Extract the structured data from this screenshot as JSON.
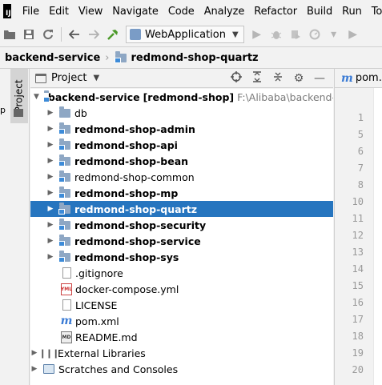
{
  "app": {
    "logo_text": "IJ"
  },
  "menu": [
    "File",
    "Edit",
    "View",
    "Navigate",
    "Code",
    "Analyze",
    "Refactor",
    "Build",
    "Run",
    "Tools"
  ],
  "toolbar": {
    "run_config": "WebApplication",
    "icons": [
      "open-folder-icon",
      "save-icon",
      "sync-icon",
      "back-icon",
      "forward-icon",
      "build-hammer-icon",
      "run-icon",
      "debug-icon",
      "coverage-icon",
      "profile-icon",
      "more-run-icon"
    ]
  },
  "breadcrumb": {
    "items": [
      "backend-service",
      "redmond-shop-quartz"
    ]
  },
  "sidebar": {
    "tab_label": "Project",
    "edge_letter": "p"
  },
  "project_panel": {
    "title": "Project",
    "tools": [
      "locate-icon",
      "expand-all-icon",
      "collapse-all-icon",
      "settings-icon",
      "minimize-icon"
    ]
  },
  "tree": {
    "root": {
      "name": "backend-service",
      "module": "[redmond-shop]",
      "path": "F:\\Alibaba\\backend-service"
    },
    "items": [
      {
        "label": "db",
        "bold": false,
        "type": "folder",
        "selected": false
      },
      {
        "label": "redmond-shop-admin",
        "bold": true,
        "type": "module",
        "selected": false
      },
      {
        "label": "redmond-shop-api",
        "bold": true,
        "type": "module",
        "selected": false
      },
      {
        "label": "redmond-shop-bean",
        "bold": true,
        "type": "module",
        "selected": false
      },
      {
        "label": "redmond-shop-common",
        "bold": false,
        "type": "module",
        "selected": false
      },
      {
        "label": "redmond-shop-mp",
        "bold": true,
        "type": "module",
        "selected": false
      },
      {
        "label": "redmond-shop-quartz",
        "bold": true,
        "type": "module",
        "selected": true
      },
      {
        "label": "redmond-shop-security",
        "bold": true,
        "type": "module",
        "selected": false
      },
      {
        "label": "redmond-shop-service",
        "bold": true,
        "type": "module",
        "selected": false
      },
      {
        "label": "redmond-shop-sys",
        "bold": true,
        "type": "module",
        "selected": false
      }
    ],
    "files": [
      {
        "label": ".gitignore",
        "icon": "generic",
        "badge": ""
      },
      {
        "label": "docker-compose.yml",
        "icon": "yml",
        "badge": "YML"
      },
      {
        "label": "LICENSE",
        "icon": "generic",
        "badge": ""
      },
      {
        "label": "pom.xml",
        "icon": "maven",
        "badge": "m"
      },
      {
        "label": "README.md",
        "icon": "md",
        "badge": "MD"
      }
    ],
    "external_libraries": "External Libraries",
    "scratches": "Scratches and Consoles"
  },
  "editor": {
    "tab_label": "pom.x",
    "tab_icon": "m",
    "line_numbers": [
      "1",
      "5",
      "6",
      "7",
      "8",
      "10",
      "11",
      "12",
      "13",
      "14",
      "15",
      "16",
      "17",
      "18",
      "19",
      "20"
    ]
  }
}
